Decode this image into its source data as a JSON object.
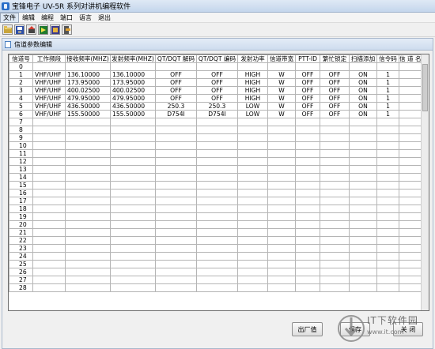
{
  "window": {
    "title": "宝锋电子 UV-5R 系列对讲机编程软件"
  },
  "menu": [
    "文件",
    "编辑",
    "编程",
    "端口",
    "语言",
    "退出"
  ],
  "toolbar": [
    "open-icon",
    "save-icon",
    "read-icon",
    "write-icon",
    "program-icon",
    "exit-icon"
  ],
  "inner_window": {
    "title": "信道参数编辑"
  },
  "grid": {
    "headers": [
      "信道号",
      "工作频段",
      "接收频率(MHZ)",
      "发射频率(MHZ)",
      "QT/DQT 解码",
      "QT/DQT 编码",
      "发射功率",
      "信道带宽",
      "PTT-ID",
      "繁忙锁定",
      "扫描添加",
      "信令码",
      "信 道 名 称"
    ],
    "rows": [
      [
        "0",
        "",
        "",
        "",
        "",
        "",
        "",
        "",
        "",
        "",
        "",
        "",
        ""
      ],
      [
        "1",
        "VHF/UHF",
        "136.10000",
        "136.10000",
        "OFF",
        "OFF",
        "HIGH",
        "W",
        "OFF",
        "OFF",
        "ON",
        "1",
        ""
      ],
      [
        "2",
        "VHF/UHF",
        "173.95000",
        "173.95000",
        "OFF",
        "OFF",
        "HIGH",
        "W",
        "OFF",
        "OFF",
        "ON",
        "1",
        ""
      ],
      [
        "3",
        "VHF/UHF",
        "400.02500",
        "400.02500",
        "OFF",
        "OFF",
        "HIGH",
        "W",
        "OFF",
        "OFF",
        "ON",
        "1",
        ""
      ],
      [
        "4",
        "VHF/UHF",
        "479.95000",
        "479.95000",
        "OFF",
        "OFF",
        "HIGH",
        "W",
        "OFF",
        "OFF",
        "ON",
        "1",
        ""
      ],
      [
        "5",
        "VHF/UHF",
        "436.50000",
        "436.50000",
        "250.3",
        "250.3",
        "LOW",
        "W",
        "OFF",
        "OFF",
        "ON",
        "1",
        ""
      ],
      [
        "6",
        "VHF/UHF",
        "155.50000",
        "155.50000",
        "D754I",
        "D754I",
        "LOW",
        "W",
        "OFF",
        "OFF",
        "ON",
        "1",
        ""
      ],
      [
        "7",
        "",
        "",
        "",
        "",
        "",
        "",
        "",
        "",
        "",
        "",
        "",
        ""
      ],
      [
        "8",
        "",
        "",
        "",
        "",
        "",
        "",
        "",
        "",
        "",
        "",
        "",
        ""
      ],
      [
        "9",
        "",
        "",
        "",
        "",
        "",
        "",
        "",
        "",
        "",
        "",
        "",
        ""
      ],
      [
        "10",
        "",
        "",
        "",
        "",
        "",
        "",
        "",
        "",
        "",
        "",
        "",
        ""
      ],
      [
        "11",
        "",
        "",
        "",
        "",
        "",
        "",
        "",
        "",
        "",
        "",
        "",
        ""
      ],
      [
        "12",
        "",
        "",
        "",
        "",
        "",
        "",
        "",
        "",
        "",
        "",
        "",
        ""
      ],
      [
        "13",
        "",
        "",
        "",
        "",
        "",
        "",
        "",
        "",
        "",
        "",
        "",
        ""
      ],
      [
        "14",
        "",
        "",
        "",
        "",
        "",
        "",
        "",
        "",
        "",
        "",
        "",
        ""
      ],
      [
        "15",
        "",
        "",
        "",
        "",
        "",
        "",
        "",
        "",
        "",
        "",
        "",
        ""
      ],
      [
        "16",
        "",
        "",
        "",
        "",
        "",
        "",
        "",
        "",
        "",
        "",
        "",
        ""
      ],
      [
        "17",
        "",
        "",
        "",
        "",
        "",
        "",
        "",
        "",
        "",
        "",
        "",
        ""
      ],
      [
        "18",
        "",
        "",
        "",
        "",
        "",
        "",
        "",
        "",
        "",
        "",
        "",
        ""
      ],
      [
        "19",
        "",
        "",
        "",
        "",
        "",
        "",
        "",
        "",
        "",
        "",
        "",
        ""
      ],
      [
        "20",
        "",
        "",
        "",
        "",
        "",
        "",
        "",
        "",
        "",
        "",
        "",
        ""
      ],
      [
        "21",
        "",
        "",
        "",
        "",
        "",
        "",
        "",
        "",
        "",
        "",
        "",
        ""
      ],
      [
        "22",
        "",
        "",
        "",
        "",
        "",
        "",
        "",
        "",
        "",
        "",
        "",
        ""
      ],
      [
        "23",
        "",
        "",
        "",
        "",
        "",
        "",
        "",
        "",
        "",
        "",
        "",
        ""
      ],
      [
        "24",
        "",
        "",
        "",
        "",
        "",
        "",
        "",
        "",
        "",
        "",
        "",
        ""
      ],
      [
        "25",
        "",
        "",
        "",
        "",
        "",
        "",
        "",
        "",
        "",
        "",
        "",
        ""
      ],
      [
        "26",
        "",
        "",
        "",
        "",
        "",
        "",
        "",
        "",
        "",
        "",
        "",
        ""
      ],
      [
        "27",
        "",
        "",
        "",
        "",
        "",
        "",
        "",
        "",
        "",
        "",
        "",
        ""
      ],
      [
        "28",
        "",
        "",
        "",
        "",
        "",
        "",
        "",
        "",
        "",
        "",
        "",
        ""
      ]
    ]
  },
  "buttons": {
    "factory": "出厂值",
    "save": "保存",
    "close": "关 闭"
  },
  "watermark": {
    "line1": "IT下软件园",
    "line2": "www.it.com"
  }
}
